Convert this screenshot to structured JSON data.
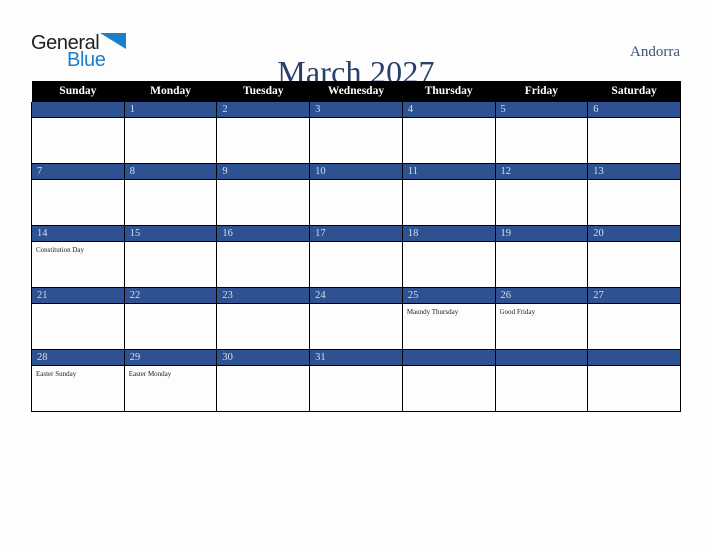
{
  "logo": {
    "word_one": "General",
    "word_two": "Blue",
    "triangle_icon": "triangle-icon",
    "brand_blue": "#1a7ec8",
    "brand_dark": "#231f20"
  },
  "header": {
    "title": "March 2027",
    "country": "Andorra",
    "title_color": "#27406b",
    "country_color": "#3c5277"
  },
  "calendar": {
    "month": "March",
    "year": "2027",
    "accent_blue": "#2d5191",
    "header_bg": "#000000",
    "cell_bg": "#fdfdfd",
    "weekdays": [
      "Sunday",
      "Monday",
      "Tuesday",
      "Wednesday",
      "Thursday",
      "Friday",
      "Saturday"
    ],
    "weeks": [
      [
        {
          "day": "",
          "events": []
        },
        {
          "day": "1",
          "events": []
        },
        {
          "day": "2",
          "events": []
        },
        {
          "day": "3",
          "events": []
        },
        {
          "day": "4",
          "events": []
        },
        {
          "day": "5",
          "events": []
        },
        {
          "day": "6",
          "events": []
        }
      ],
      [
        {
          "day": "7",
          "events": []
        },
        {
          "day": "8",
          "events": []
        },
        {
          "day": "9",
          "events": []
        },
        {
          "day": "10",
          "events": []
        },
        {
          "day": "11",
          "events": []
        },
        {
          "day": "12",
          "events": []
        },
        {
          "day": "13",
          "events": []
        }
      ],
      [
        {
          "day": "14",
          "events": [
            "Constitution Day"
          ]
        },
        {
          "day": "15",
          "events": []
        },
        {
          "day": "16",
          "events": []
        },
        {
          "day": "17",
          "events": []
        },
        {
          "day": "18",
          "events": []
        },
        {
          "day": "19",
          "events": []
        },
        {
          "day": "20",
          "events": []
        }
      ],
      [
        {
          "day": "21",
          "events": []
        },
        {
          "day": "22",
          "events": []
        },
        {
          "day": "23",
          "events": []
        },
        {
          "day": "24",
          "events": []
        },
        {
          "day": "25",
          "events": [
            "Maundy Thursday"
          ]
        },
        {
          "day": "26",
          "events": [
            "Good Friday"
          ]
        },
        {
          "day": "27",
          "events": []
        }
      ],
      [
        {
          "day": "28",
          "events": [
            "Easter Sunday"
          ]
        },
        {
          "day": "29",
          "events": [
            "Easter Monday"
          ]
        },
        {
          "day": "30",
          "events": []
        },
        {
          "day": "31",
          "events": []
        },
        {
          "day": "",
          "events": []
        },
        {
          "day": "",
          "events": []
        },
        {
          "day": "",
          "events": []
        }
      ]
    ]
  }
}
